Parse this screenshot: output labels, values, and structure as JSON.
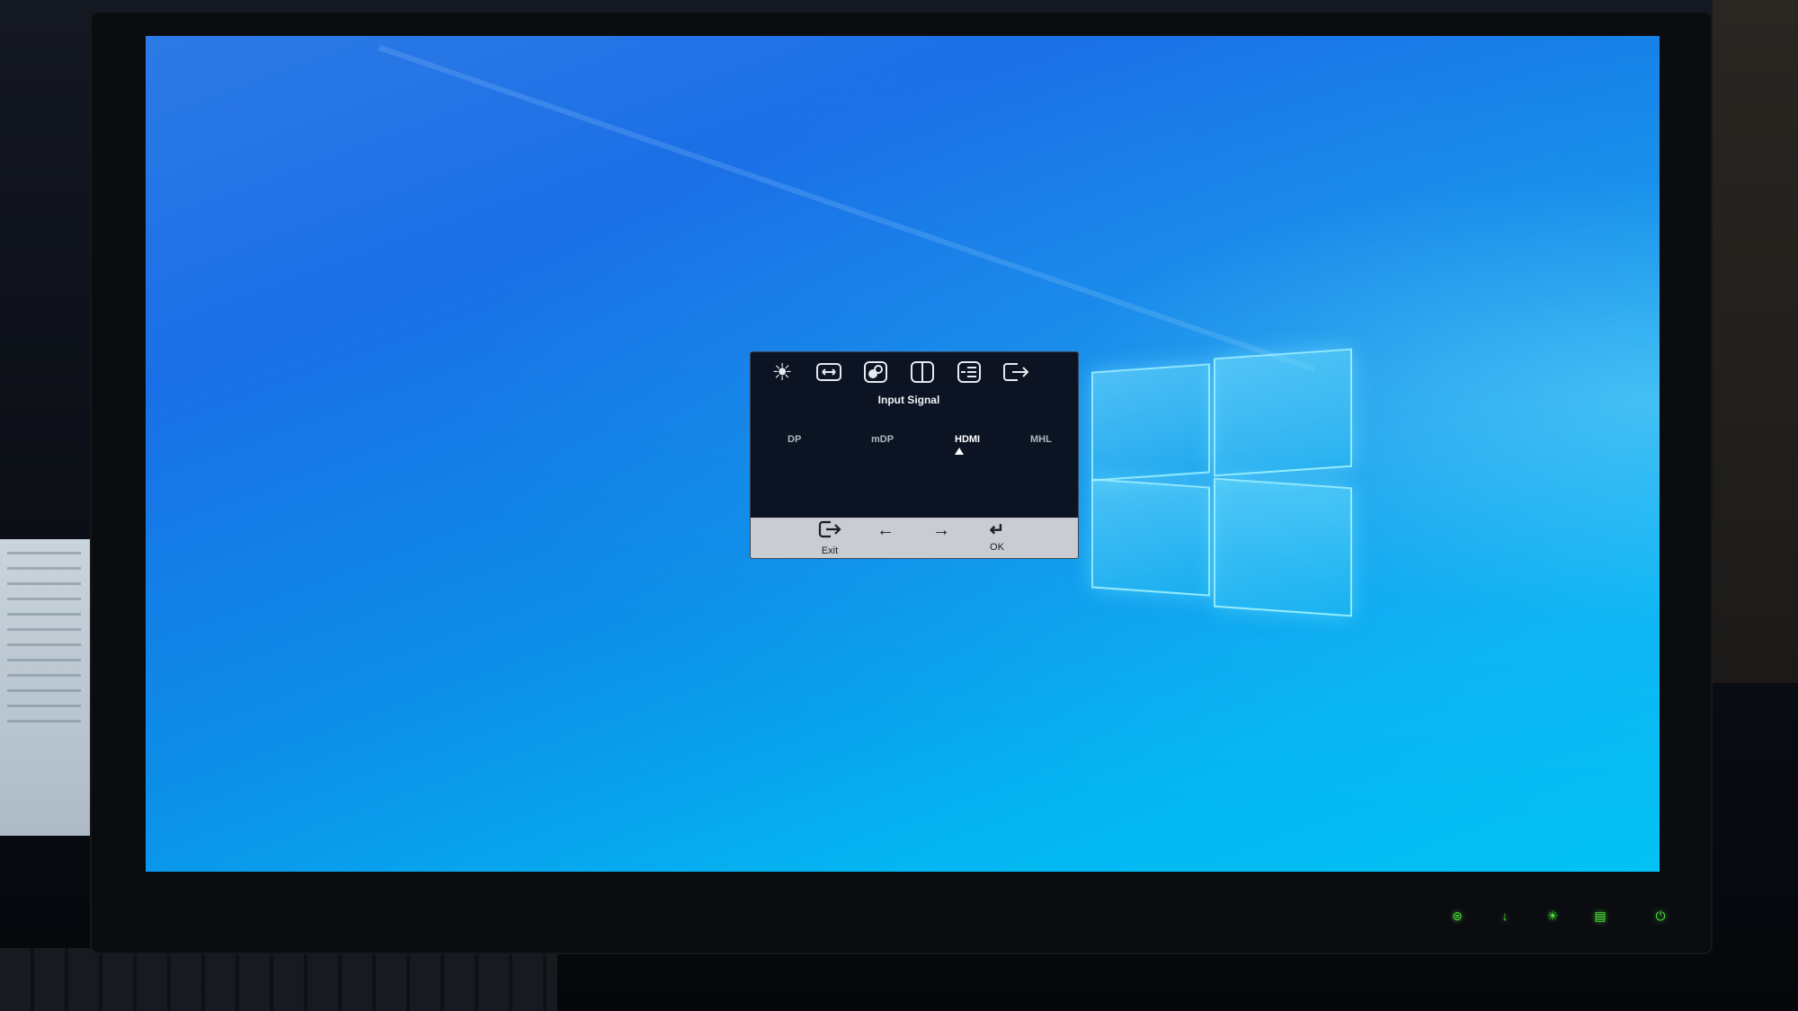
{
  "osd": {
    "title": "Input Signal",
    "tab_icons": [
      "brightness-icon",
      "image-setup-icon",
      "color-icon",
      "split-screen-icon",
      "menu-options-icon",
      "exit-icon"
    ],
    "inputs": [
      {
        "label": "DP",
        "selected": false
      },
      {
        "label": "mDP",
        "selected": false
      },
      {
        "label": "HDMI",
        "selected": true
      },
      {
        "label": "MHL",
        "selected": false
      }
    ],
    "footer": {
      "exit_label": "Exit",
      "ok_label": "OK",
      "left_icon": "arrow-left-icon",
      "right_icon": "arrow-right-icon"
    }
  },
  "front_buttons": [
    "input-source-button",
    "down-button",
    "brightness-button",
    "menu-button",
    "power-button"
  ],
  "colors": {
    "desktop_blue": "#1a6fe6",
    "desktop_cyan": "#04b6f2",
    "osd_background": "#0c1424",
    "osd_footer": "#c9ccd2",
    "led_green": "#4bdc3a"
  }
}
